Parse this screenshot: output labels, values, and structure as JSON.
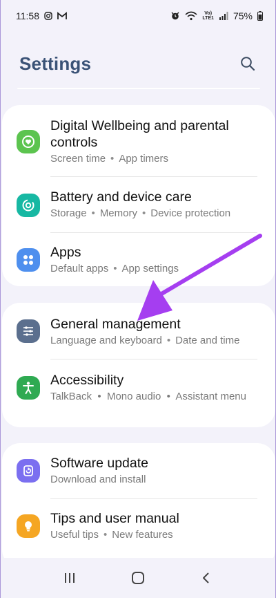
{
  "status_bar": {
    "time": "11:58",
    "network_label_top": "Vo)",
    "network_label_bottom": "LTE1",
    "battery": "75%"
  },
  "header": {
    "title": "Settings",
    "search_icon": "search-icon"
  },
  "cards": [
    {
      "items": [
        {
          "title": "Digital Wellbeing and parental controls",
          "subtitle": [
            "Screen time",
            "App timers"
          ],
          "icon": "digital-wellbeing-icon",
          "icon_color": "#5cc44f"
        },
        {
          "title": "Battery and device care",
          "subtitle": [
            "Storage",
            "Memory",
            "Device protection"
          ],
          "icon": "device-care-icon",
          "icon_color": "#17b8a3"
        },
        {
          "title": "Apps",
          "subtitle": [
            "Default apps",
            "App settings"
          ],
          "icon": "apps-icon",
          "icon_color": "#4e8fee"
        }
      ]
    },
    {
      "items": [
        {
          "title": "General management",
          "subtitle": [
            "Language and keyboard",
            "Date and time"
          ],
          "icon": "general-management-icon",
          "icon_color": "#5b6f8e"
        },
        {
          "title": "Accessibility",
          "subtitle_text": "TalkBack  •  Mono audio  •  Assistant menu",
          "icon": "accessibility-icon",
          "icon_color": "#2faa52"
        }
      ]
    },
    {
      "items": [
        {
          "title": "Software update",
          "subtitle": [
            "Download and install"
          ],
          "icon": "software-update-icon",
          "icon_color": "#7b6ff0"
        },
        {
          "title": "Tips and user manual",
          "subtitle": [
            "Useful tips",
            "New features"
          ],
          "icon": "tips-icon",
          "icon_color": "#f5a623"
        }
      ]
    }
  ],
  "annotation": {
    "arrow_color": "#a53ef0"
  },
  "nav_bar": {
    "recents_icon": "recents-icon",
    "home_icon": "home-icon",
    "back_icon": "back-icon"
  }
}
